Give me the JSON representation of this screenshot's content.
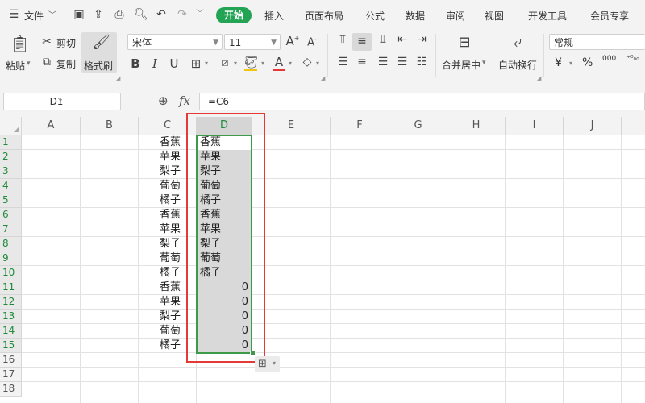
{
  "menu": {
    "file": "文件",
    "tabs": [
      "开始",
      "插入",
      "页面布局",
      "公式",
      "数据",
      "审阅",
      "视图",
      "开发工具",
      "会员专享"
    ],
    "active_tab_color": "#23a455"
  },
  "ribbon": {
    "paste": "粘贴",
    "cut": "剪切",
    "copy": "复制",
    "format_painter": "格式刷",
    "font_name": "宋体",
    "font_size": "11",
    "merge_center": "合并居中",
    "wrap_text": "自动换行",
    "number_format": "常规",
    "currency_symbol": "¥",
    "percent_symbol": "%",
    "thousands": "000"
  },
  "formula_bar": {
    "name_box": "D1",
    "fx": "fx",
    "formula": "=C6"
  },
  "grid": {
    "columns": [
      "A",
      "B",
      "C",
      "D",
      "E",
      "F",
      "G",
      "H",
      "I",
      "J"
    ],
    "rows": [
      "1",
      "2",
      "3",
      "4",
      "5",
      "6",
      "7",
      "8",
      "9",
      "10",
      "11",
      "12",
      "13",
      "14",
      "15",
      "16",
      "17",
      "18"
    ],
    "column_c": [
      "香蕉",
      "苹果",
      "梨子",
      "葡萄",
      "橘子",
      "香蕉",
      "苹果",
      "梨子",
      "葡萄",
      "橘子",
      "香蕉",
      "苹果",
      "梨子",
      "葡萄",
      "橘子"
    ],
    "column_d": [
      "香蕉",
      "苹果",
      "梨子",
      "葡萄",
      "橘子",
      "香蕉",
      "苹果",
      "梨子",
      "葡萄",
      "橘子",
      "0",
      "0",
      "0",
      "0",
      "0"
    ],
    "selection_color": "#3e9a49",
    "highlight_color": "#e53935"
  }
}
